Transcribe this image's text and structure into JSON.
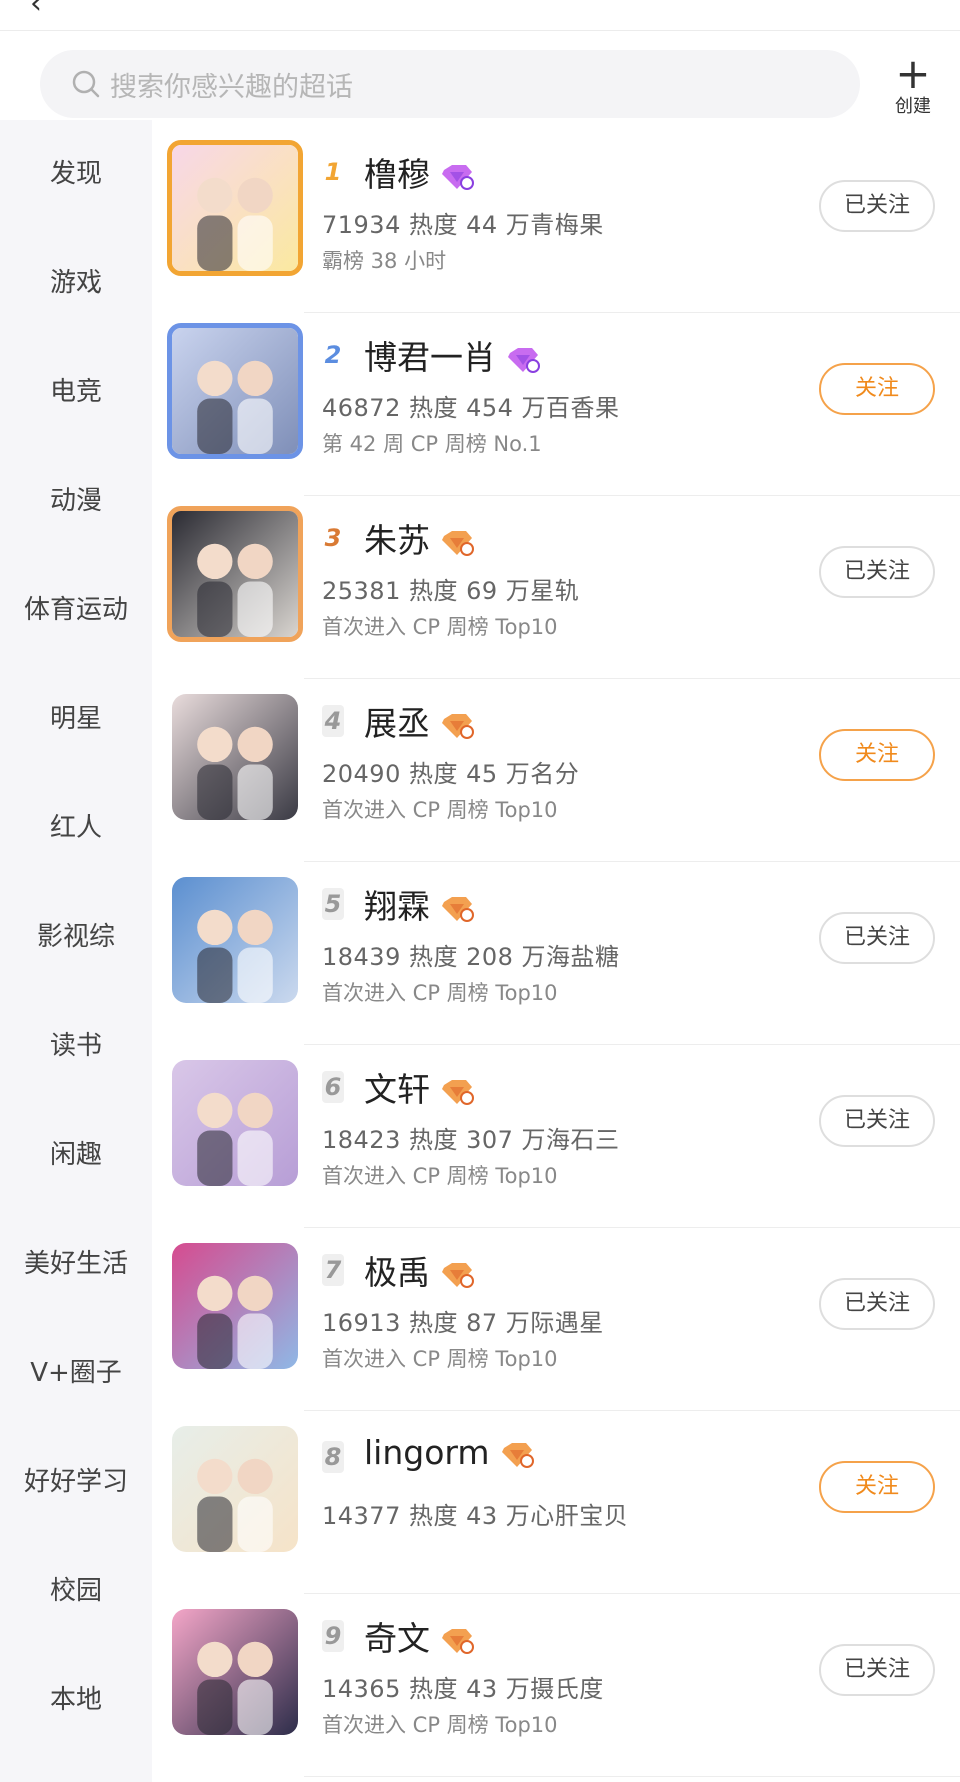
{
  "header": {
    "back_glyph": "‹"
  },
  "search": {
    "placeholder": "搜索你感兴趣的超话"
  },
  "create": {
    "label": "创建"
  },
  "sidebar": [
    "发现",
    "游戏",
    "电竞",
    "动漫",
    "体育运动",
    "明星",
    "红人",
    "影视综",
    "读书",
    "闲趣",
    "美好生活",
    "V+圈子",
    "好好学习",
    "校园",
    "本地"
  ],
  "colors": {
    "accent_orange": "#f08a1c",
    "rank1": "#f2a533",
    "rank2": "#5b8de0",
    "rank3": "#d97a34",
    "rank_other": "#999999"
  },
  "items": [
    {
      "rank": "1",
      "name": "橹穆",
      "badge": "diamond-purple",
      "stats": "71934 热度  44 万青梅果",
      "sub": "霸榜 38 小时",
      "button": "已关注",
      "followed": true
    },
    {
      "rank": "2",
      "name": "博君一肖",
      "badge": "diamond-purple",
      "stats": "46872 热度  454 万百香果",
      "sub": "第 42 周 CP 周榜 No.1",
      "button": "关注",
      "followed": false
    },
    {
      "rank": "3",
      "name": "朱苏",
      "badge": "diamond-orange",
      "stats": "25381 热度  69 万星轨",
      "sub": "首次进入 CP 周榜 Top10",
      "button": "已关注",
      "followed": true
    },
    {
      "rank": "4",
      "name": "展丞",
      "badge": "diamond-orange",
      "stats": "20490 热度  45 万名分",
      "sub": "首次进入 CP 周榜 Top10",
      "button": "关注",
      "followed": false
    },
    {
      "rank": "5",
      "name": "翔霖",
      "badge": "diamond-orange",
      "stats": "18439 热度  208 万海盐糖",
      "sub": "首次进入 CP 周榜 Top10",
      "button": "已关注",
      "followed": true
    },
    {
      "rank": "6",
      "name": "文轩",
      "badge": "diamond-orange",
      "stats": "18423 热度  307 万海石三",
      "sub": "首次进入 CP 周榜 Top10",
      "button": "已关注",
      "followed": true
    },
    {
      "rank": "7",
      "name": "极禹",
      "badge": "diamond-orange",
      "stats": "16913 热度  87 万际遇星",
      "sub": "首次进入 CP 周榜 Top10",
      "button": "已关注",
      "followed": true
    },
    {
      "rank": "8",
      "name": "lingorm",
      "badge": "diamond-orange",
      "stats": "14377 热度  43 万心肝宝贝",
      "sub": "",
      "button": "关注",
      "followed": false
    },
    {
      "rank": "9",
      "name": "奇文",
      "badge": "diamond-orange",
      "stats": "14365 热度  43 万摄氏度",
      "sub": "首次进入 CP 周榜 Top10",
      "button": "已关注",
      "followed": true
    }
  ]
}
